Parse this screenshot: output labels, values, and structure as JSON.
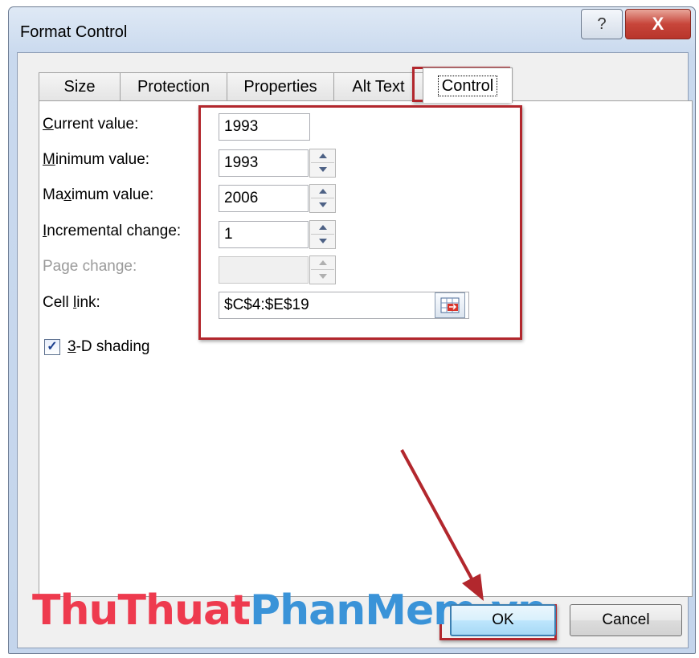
{
  "window": {
    "title": "Format Control",
    "help_symbol": "?",
    "close_symbol": "X"
  },
  "tabs": [
    {
      "label": "Size"
    },
    {
      "label": "Protection"
    },
    {
      "label": "Properties"
    },
    {
      "label": "Alt Text"
    },
    {
      "label": "Control",
      "active": true
    }
  ],
  "form": {
    "current_value": {
      "label_pre": "",
      "label_key": "C",
      "label_post": "urrent value:",
      "value": "1993"
    },
    "minimum_value": {
      "label_pre": "",
      "label_key": "M",
      "label_post": "inimum value:",
      "value": "1993"
    },
    "maximum_value": {
      "label_pre": "Ma",
      "label_key": "x",
      "label_post": "imum value:",
      "value": "2006"
    },
    "incremental_change": {
      "label_pre": "",
      "label_key": "I",
      "label_post": "ncremental change:",
      "value": "1"
    },
    "page_change": {
      "label": "Page change:",
      "value": ""
    },
    "cell_link": {
      "label_pre": "Cell ",
      "label_key": "l",
      "label_post": "ink:",
      "value": "$C$4:$E$19"
    },
    "shading": {
      "label_pre": "",
      "label_key": "3",
      "label_post": "-D shading",
      "checked": true
    }
  },
  "buttons": {
    "ok": "OK",
    "cancel": "Cancel"
  },
  "watermark": {
    "part1": "ThuThuat",
    "part2": "PhanMem.vn"
  },
  "colors": {
    "highlight": "#b2272d",
    "title_gradient_top": "#dfe9f5",
    "close_button": "#c7453a"
  }
}
